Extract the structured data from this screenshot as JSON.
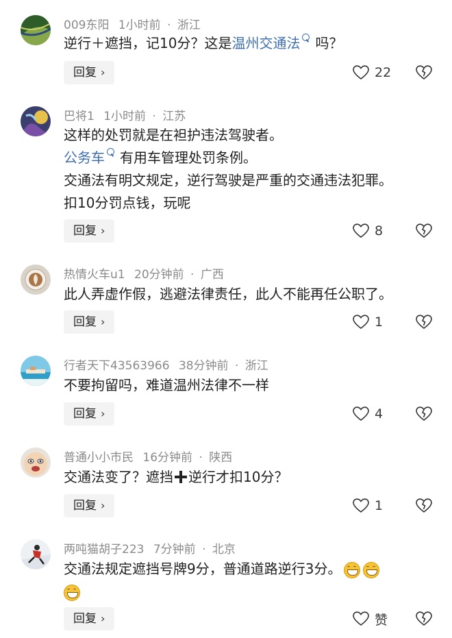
{
  "comments": [
    {
      "user": "009东阳",
      "time": "1小时前",
      "region": "浙江",
      "segments_line1": {
        "pre": "逆行＋遮挡，记10分？这是",
        "link": "温州交通法",
        "post": "吗？"
      },
      "likes": "22",
      "reply_label": "回复"
    },
    {
      "user": "巴将1",
      "time": "1小时前",
      "region": "江苏",
      "line1": "这样的处罚就是在袒护违法驾驶者。",
      "line2_link": "公务车",
      "line2_post": "有用车管理处罚条例。",
      "line3": "交通法有明文规定，逆行驾驶是严重的交通违法犯罪。",
      "line4": "扣10分罚点钱，玩呢",
      "likes": "8",
      "reply_label": "回复"
    },
    {
      "user": "热情火车u1",
      "time": "20分钟前",
      "region": "广西",
      "line1": "此人弄虚作假，逃避法律责任，此人不能再任公职了。",
      "likes": "1",
      "reply_label": "回复"
    },
    {
      "user": "行者天下43563966",
      "time": "38分钟前",
      "region": "浙江",
      "line1": "不要拘留吗，难道温州法律不一样",
      "likes": "4",
      "reply_label": "回复"
    },
    {
      "user": "普通小小市民",
      "time": "16分钟前",
      "region": "陕西",
      "line1_pre": "交通法变了？遮挡",
      "line1_post": "逆行才扣10分？",
      "likes": "1",
      "reply_label": "回复"
    },
    {
      "user": "两吨猫胡子223",
      "time": "7分钟前",
      "region": "北京",
      "line1": "交通法规定遮挡号牌9分，普通道路逆行3分。",
      "likes": "赞",
      "reply_label": "回复"
    }
  ],
  "separator": "·",
  "reply_chevron": "›",
  "icons": {
    "like": "heart-outline-icon",
    "dislike": "broken-heart-icon",
    "search": "search-icon",
    "emoji": "grinning-face-emoji",
    "plus": "heavy-plus-icon"
  },
  "colors": {
    "link": "#3f6fb0",
    "meta": "#8a8a8a",
    "reply_bg": "#f3f3f3"
  }
}
